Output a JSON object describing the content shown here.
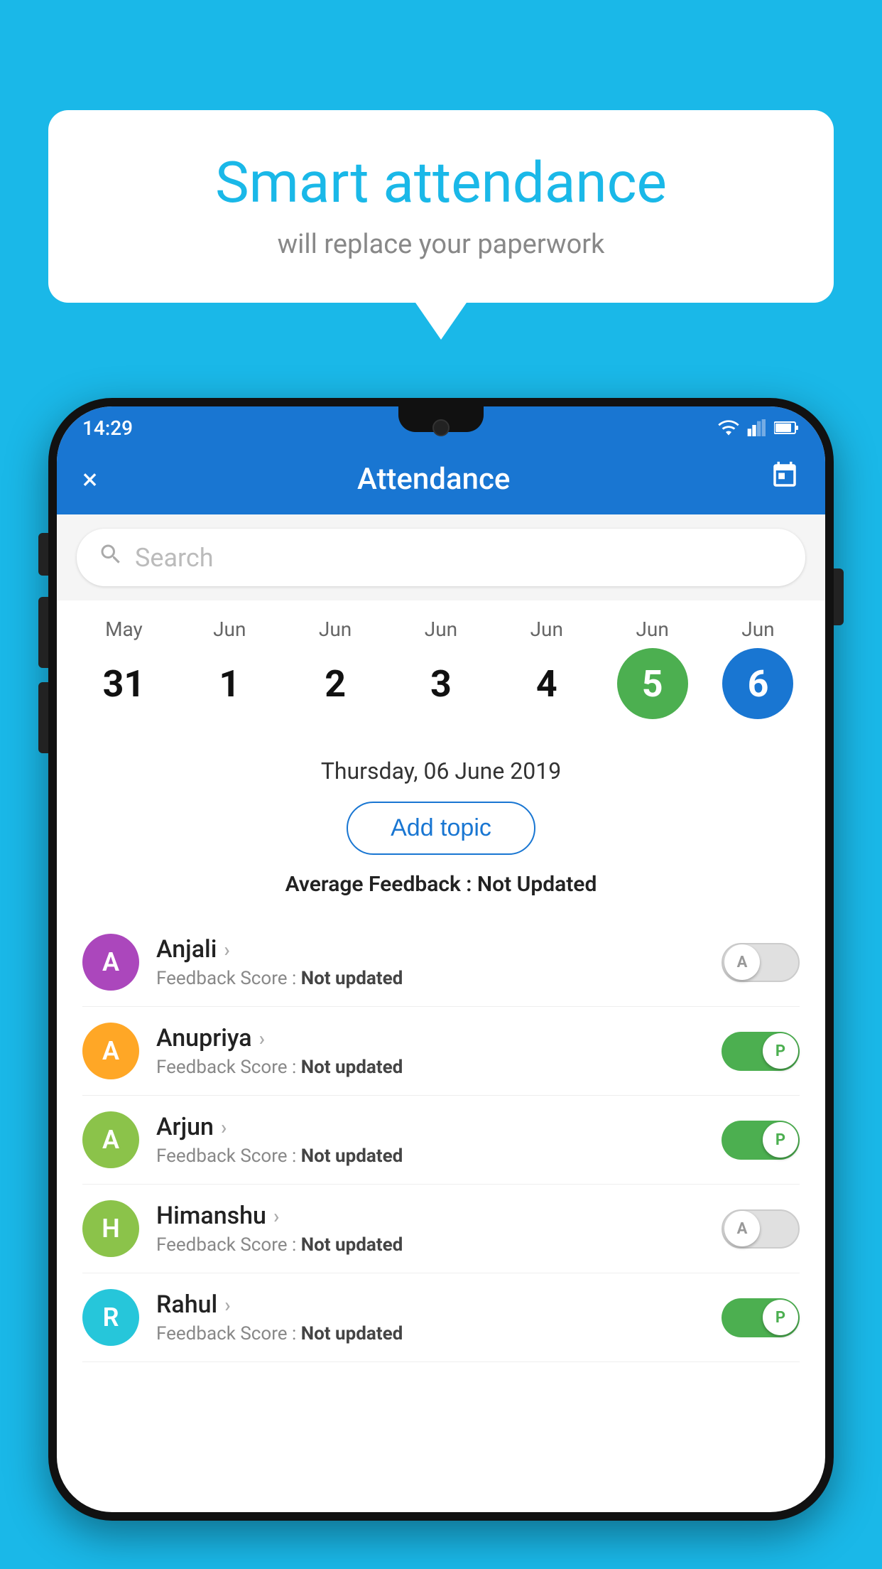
{
  "background_color": "#1ab8e8",
  "bubble": {
    "title": "Smart attendance",
    "subtitle": "will replace your paperwork"
  },
  "status_bar": {
    "time": "14:29"
  },
  "app_bar": {
    "title": "Attendance",
    "close_label": "×",
    "calendar_label": "📅"
  },
  "search": {
    "placeholder": "Search"
  },
  "dates": [
    {
      "month": "May",
      "day": "31",
      "state": "normal"
    },
    {
      "month": "Jun",
      "day": "1",
      "state": "normal"
    },
    {
      "month": "Jun",
      "day": "2",
      "state": "normal"
    },
    {
      "month": "Jun",
      "day": "3",
      "state": "normal"
    },
    {
      "month": "Jun",
      "day": "4",
      "state": "normal"
    },
    {
      "month": "Jun",
      "day": "5",
      "state": "today"
    },
    {
      "month": "Jun",
      "day": "6",
      "state": "selected"
    }
  ],
  "selected_date_label": "Thursday, 06 June 2019",
  "add_topic_label": "Add topic",
  "avg_feedback_label": "Average Feedback : ",
  "avg_feedback_value": "Not Updated",
  "students": [
    {
      "name": "Anjali",
      "avatar_letter": "A",
      "avatar_color": "#ab47bc",
      "feedback_label": "Feedback Score : ",
      "feedback_value": "Not updated",
      "attendance": "absent",
      "toggle_letter": "A"
    },
    {
      "name": "Anupriya",
      "avatar_letter": "A",
      "avatar_color": "#ffa726",
      "feedback_label": "Feedback Score : ",
      "feedback_value": "Not updated",
      "attendance": "present",
      "toggle_letter": "P"
    },
    {
      "name": "Arjun",
      "avatar_letter": "A",
      "avatar_color": "#8bc34a",
      "feedback_label": "Feedback Score : ",
      "feedback_value": "Not updated",
      "attendance": "present",
      "toggle_letter": "P"
    },
    {
      "name": "Himanshu",
      "avatar_letter": "H",
      "avatar_color": "#8bc34a",
      "feedback_label": "Feedback Score : ",
      "feedback_value": "Not updated",
      "attendance": "absent",
      "toggle_letter": "A"
    },
    {
      "name": "Rahul",
      "avatar_letter": "R",
      "avatar_color": "#26c6da",
      "feedback_label": "Feedback Score : ",
      "feedback_value": "Not updated",
      "attendance": "present",
      "toggle_letter": "P"
    }
  ]
}
